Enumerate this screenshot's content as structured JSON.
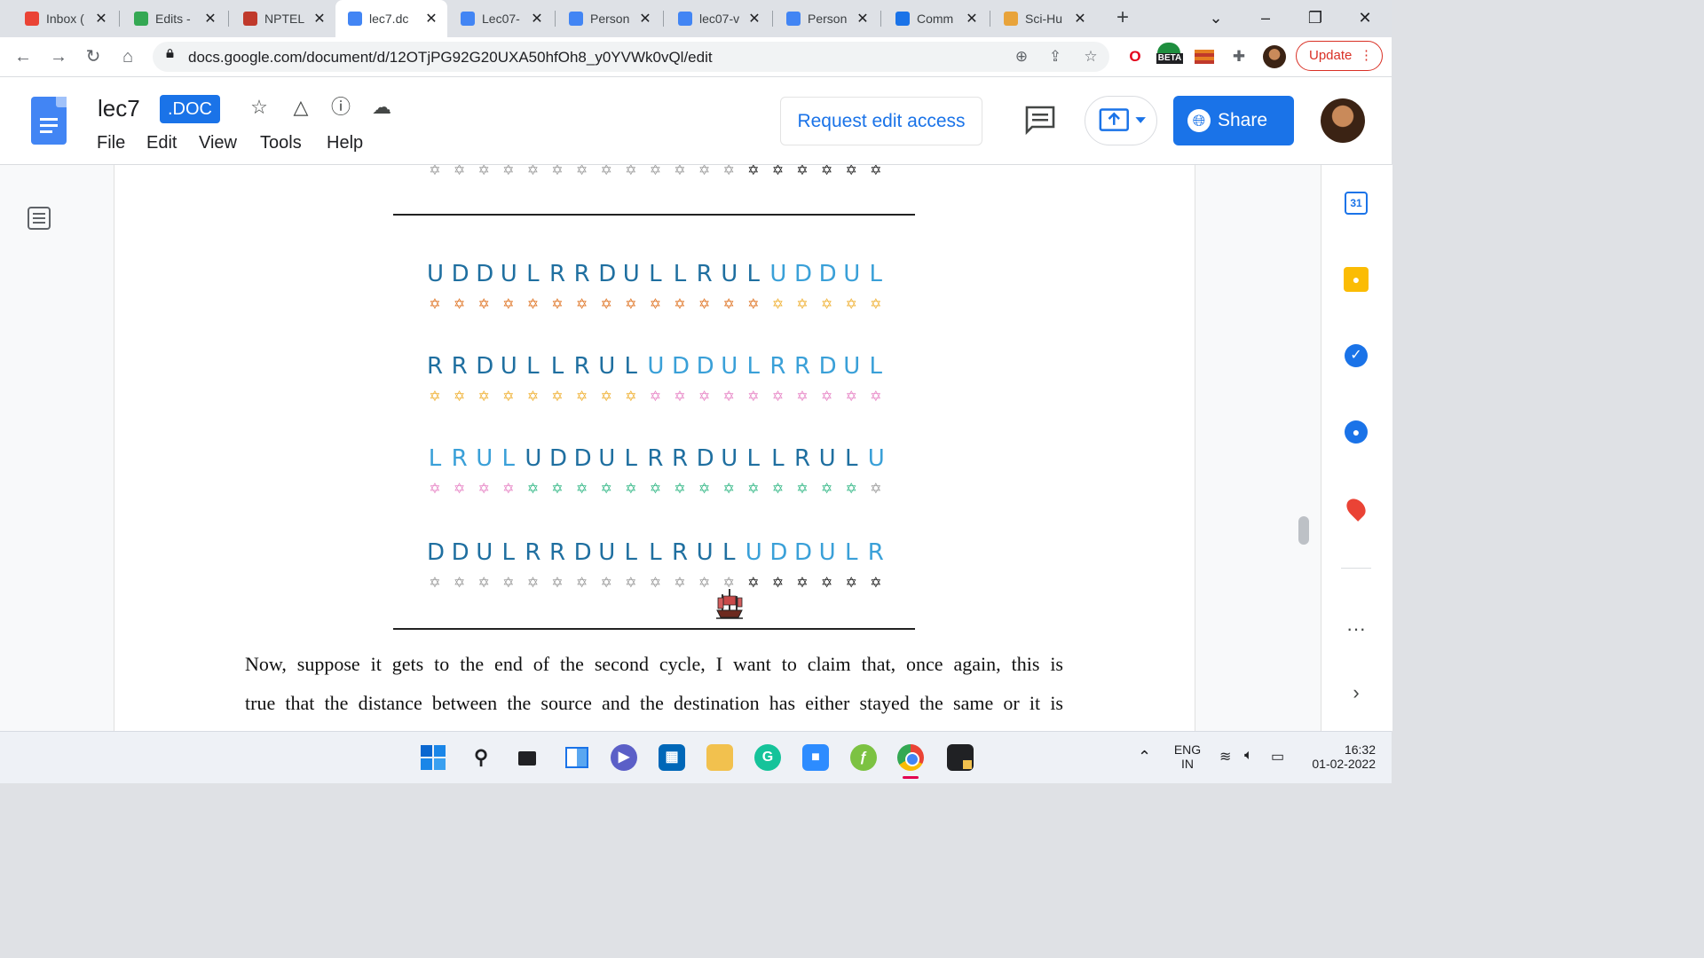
{
  "tabs": [
    {
      "title": "Inbox (",
      "favicon": "gmail-icon",
      "color": "#ea4335",
      "active": false
    },
    {
      "title": "Edits -",
      "favicon": "drive-icon",
      "color": "#34a853",
      "active": false
    },
    {
      "title": "NPTEL",
      "favicon": "nptel-icon",
      "color": "#c0392b",
      "active": false
    },
    {
      "title": "lec7.dc",
      "favicon": "docs-icon",
      "color": "#4285f4",
      "active": true
    },
    {
      "title": "Lec07-",
      "favicon": "docs-icon",
      "color": "#4285f4",
      "active": false
    },
    {
      "title": "Person",
      "favicon": "docs-icon",
      "color": "#4285f4",
      "active": false
    },
    {
      "title": "lec07-v",
      "favicon": "docs-icon",
      "color": "#4285f4",
      "active": false
    },
    {
      "title": "Person",
      "favicon": "docs-icon",
      "color": "#4285f4",
      "active": false
    },
    {
      "title": "Comm",
      "favicon": "link-icon",
      "color": "#1a73e8",
      "active": false
    },
    {
      "title": "Sci-Hu",
      "favicon": "scihub-icon",
      "color": "#e8a33a",
      "active": false
    }
  ],
  "browser": {
    "url": "docs.google.com/document/d/12OTjPG92G20UXA50hfOh8_y0YVWk0vQl/edit",
    "update_label": "Update",
    "beta_label": "BETA"
  },
  "doc": {
    "title": "lec7",
    "badge": ".DOC",
    "menus": [
      "File",
      "Edit",
      "View",
      "Tools",
      "Help"
    ],
    "request_access": "Request edit access",
    "share": "Share"
  },
  "figure": {
    "top_stars": [
      {
        "c": "#9e9e9e",
        "n": 13
      },
      {
        "c": "#222222",
        "n": 6
      }
    ],
    "rows": [
      {
        "letters": [
          "U",
          "D",
          "D",
          "U",
          "L",
          "R",
          "R",
          "D",
          "U",
          "L",
          "L",
          "R",
          "U",
          "L",
          "U",
          "D",
          "D",
          "U",
          "L"
        ],
        "letter_colors": [
          "#1f6fa0",
          "#1f6fa0",
          "#1f6fa0",
          "#1f6fa0",
          "#1f6fa0",
          "#1f6fa0",
          "#1f6fa0",
          "#1f6fa0",
          "#1f6fa0",
          "#1f6fa0",
          "#1f6fa0",
          "#1f6fa0",
          "#1f6fa0",
          "#1f6fa0",
          "#3aa0d8",
          "#3aa0d8",
          "#3aa0d8",
          "#3aa0d8",
          "#3aa0d8"
        ],
        "star_colors": [
          "#e07a2e",
          "#e07a2e",
          "#e07a2e",
          "#e07a2e",
          "#e07a2e",
          "#e07a2e",
          "#e07a2e",
          "#e07a2e",
          "#e07a2e",
          "#e07a2e",
          "#e07a2e",
          "#e07a2e",
          "#e07a2e",
          "#e07a2e",
          "#f0b43c",
          "#f0b43c",
          "#f0b43c",
          "#f0b43c",
          "#f0b43c"
        ]
      },
      {
        "letters": [
          "R",
          "R",
          "D",
          "U",
          "L",
          "L",
          "R",
          "U",
          "L",
          "U",
          "D",
          "D",
          "U",
          "L",
          "R",
          "R",
          "D",
          "U",
          "L"
        ],
        "letter_colors": [
          "#1f6fa0",
          "#1f6fa0",
          "#1f6fa0",
          "#1f6fa0",
          "#1f6fa0",
          "#1f6fa0",
          "#1f6fa0",
          "#1f6fa0",
          "#1f6fa0",
          "#3aa0d8",
          "#3aa0d8",
          "#3aa0d8",
          "#3aa0d8",
          "#3aa0d8",
          "#3aa0d8",
          "#3aa0d8",
          "#3aa0d8",
          "#3aa0d8",
          "#3aa0d8"
        ],
        "star_colors": [
          "#f0b43c",
          "#f0b43c",
          "#f0b43c",
          "#f0b43c",
          "#f0b43c",
          "#f0b43c",
          "#f0b43c",
          "#f0b43c",
          "#f0b43c",
          "#e88ac8",
          "#e88ac8",
          "#e88ac8",
          "#e88ac8",
          "#e88ac8",
          "#e88ac8",
          "#e88ac8",
          "#e88ac8",
          "#e88ac8",
          "#e88ac8"
        ]
      },
      {
        "letters": [
          "L",
          "R",
          "U",
          "L",
          "U",
          "D",
          "D",
          "U",
          "L",
          "R",
          "R",
          "D",
          "U",
          "L",
          "L",
          "R",
          "U",
          "L",
          "U"
        ],
        "letter_colors": [
          "#3aa0d8",
          "#3aa0d8",
          "#3aa0d8",
          "#3aa0d8",
          "#1f6fa0",
          "#1f6fa0",
          "#1f6fa0",
          "#1f6fa0",
          "#1f6fa0",
          "#1f6fa0",
          "#1f6fa0",
          "#1f6fa0",
          "#1f6fa0",
          "#1f6fa0",
          "#1f6fa0",
          "#1f6fa0",
          "#1f6fa0",
          "#1f6fa0",
          "#3aa0d8"
        ],
        "star_colors": [
          "#e88ac8",
          "#e88ac8",
          "#e88ac8",
          "#e88ac8",
          "#3dbb8c",
          "#3dbb8c",
          "#3dbb8c",
          "#3dbb8c",
          "#3dbb8c",
          "#3dbb8c",
          "#3dbb8c",
          "#3dbb8c",
          "#3dbb8c",
          "#3dbb8c",
          "#3dbb8c",
          "#3dbb8c",
          "#3dbb8c",
          "#3dbb8c",
          "#9e9e9e"
        ]
      },
      {
        "letters": [
          "D",
          "D",
          "U",
          "L",
          "R",
          "R",
          "D",
          "U",
          "L",
          "L",
          "R",
          "U",
          "L",
          "U",
          "D",
          "D",
          "U",
          "L",
          "R"
        ],
        "letter_colors": [
          "#1f6fa0",
          "#1f6fa0",
          "#1f6fa0",
          "#1f6fa0",
          "#1f6fa0",
          "#1f6fa0",
          "#1f6fa0",
          "#1f6fa0",
          "#1f6fa0",
          "#1f6fa0",
          "#1f6fa0",
          "#1f6fa0",
          "#1f6fa0",
          "#3aa0d8",
          "#3aa0d8",
          "#3aa0d8",
          "#3aa0d8",
          "#3aa0d8",
          "#3aa0d8"
        ],
        "star_colors": [
          "#9e9e9e",
          "#9e9e9e",
          "#9e9e9e",
          "#9e9e9e",
          "#9e9e9e",
          "#9e9e9e",
          "#9e9e9e",
          "#9e9e9e",
          "#9e9e9e",
          "#9e9e9e",
          "#9e9e9e",
          "#9e9e9e",
          "#9e9e9e",
          "#222222",
          "#222222",
          "#222222",
          "#222222",
          "#222222",
          "#222222"
        ]
      }
    ]
  },
  "paragraph": [
    "Now, suppose it gets to the end of the second cycle, I want to claim that, once again, this is",
    "true that the distance between the source and the destination has either stayed the same or it is"
  ],
  "taskbar": {
    "lang_top": "ENG",
    "lang_bottom": "IN",
    "time": "16:32",
    "date": "01-02-2022"
  }
}
